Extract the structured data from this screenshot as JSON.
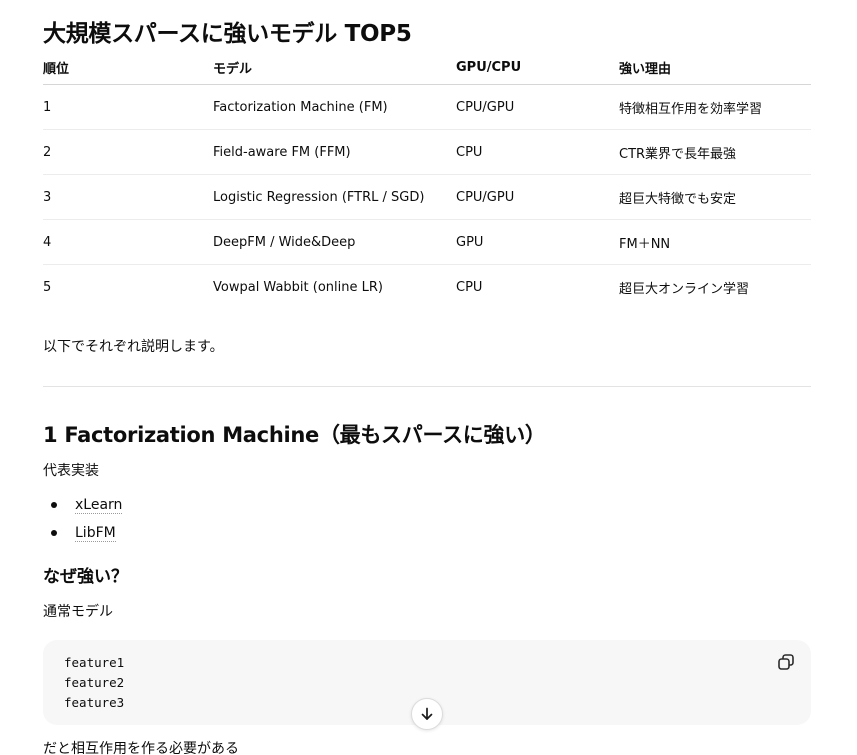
{
  "title": "大規模スパースに強いモデル TOP5",
  "table": {
    "headers": [
      "順位",
      "モデル",
      "GPU/CPU",
      "強い理由"
    ],
    "rows": [
      [
        "1",
        "Factorization Machine (FM)",
        "CPU/GPU",
        "特徴相互作用を効率学習"
      ],
      [
        "2",
        "Field-aware FM (FFM)",
        "CPU",
        "CTR業界で長年最強"
      ],
      [
        "3",
        "Logistic Regression (FTRL / SGD)",
        "CPU/GPU",
        "超巨大特徴でも安定"
      ],
      [
        "4",
        "DeepFM / Wide&Deep",
        "GPU",
        "FM＋NN"
      ],
      [
        "5",
        "Vowpal Wabbit (online LR)",
        "CPU",
        "超巨大オンライン学習"
      ]
    ]
  },
  "intro_text": "以下でそれぞれ説明します。",
  "section": {
    "heading": "1 Factorization Machine（最もスパースに強い）",
    "impl_label": "代表実装",
    "impl_links": [
      "xLearn",
      "LibFM"
    ],
    "why_heading": "なぜ強い？",
    "normal_model_label": "通常モデル",
    "code_lines": [
      "feature1",
      "feature2",
      "feature3"
    ],
    "after_code_text": "だと相互作用を作る必要がある"
  },
  "icons": {
    "copy": "copy-icon",
    "scroll_down": "arrow-down-icon"
  }
}
